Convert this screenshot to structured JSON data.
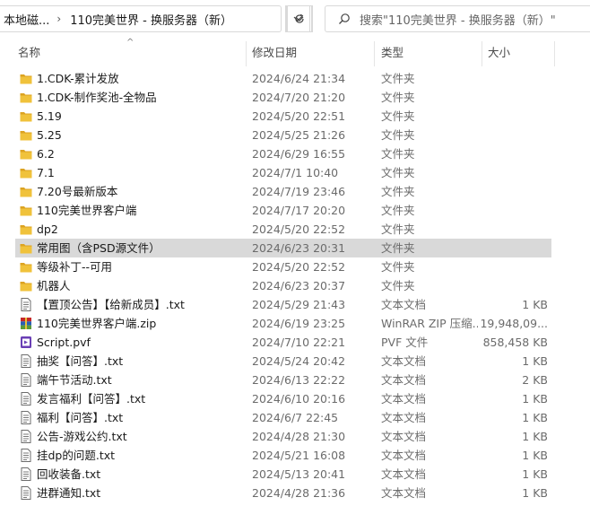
{
  "address": {
    "root": "本地磁...",
    "separator": "›",
    "current": "110完美世界 - 换服务器（新）",
    "dropdown_icon": "⌄",
    "refresh_icon": "↻"
  },
  "search": {
    "placeholder": "搜索\"110完美世界 - 换服务器（新）\""
  },
  "header": {
    "name": "名称",
    "date": "修改日期",
    "type": "类型",
    "size": "大小",
    "sort_indicator": "^"
  },
  "files": [
    {
      "name": "1.CDK-累计发放",
      "date": "2024/6/24 21:34",
      "type": "文件夹",
      "size": "",
      "icon": "folder-icon"
    },
    {
      "name": "1.CDK-制作奖池-全物品",
      "date": "2024/7/20 21:20",
      "type": "文件夹",
      "size": "",
      "icon": "folder-icon"
    },
    {
      "name": "5.19",
      "date": "2024/5/20 22:51",
      "type": "文件夹",
      "size": "",
      "icon": "folder-icon"
    },
    {
      "name": "5.25",
      "date": "2024/5/25 21:26",
      "type": "文件夹",
      "size": "",
      "icon": "folder-icon"
    },
    {
      "name": "6.2",
      "date": "2024/6/29 16:55",
      "type": "文件夹",
      "size": "",
      "icon": "folder-icon"
    },
    {
      "name": "7.1",
      "date": "2024/7/1 10:40",
      "type": "文件夹",
      "size": "",
      "icon": "folder-icon"
    },
    {
      "name": "7.20号最新版本",
      "date": "2024/7/19 23:46",
      "type": "文件夹",
      "size": "",
      "icon": "folder-icon"
    },
    {
      "name": "110完美世界客户端",
      "date": "2024/7/17 20:20",
      "type": "文件夹",
      "size": "",
      "icon": "folder-icon"
    },
    {
      "name": "dp2",
      "date": "2024/5/20 22:52",
      "type": "文件夹",
      "size": "",
      "icon": "folder-icon"
    },
    {
      "name": "常用图（含PSD源文件）",
      "date": "2024/6/23 20:31",
      "type": "文件夹",
      "size": "",
      "icon": "folder-icon",
      "selected": true
    },
    {
      "name": "等级补丁--可用",
      "date": "2024/5/20 22:52",
      "type": "文件夹",
      "size": "",
      "icon": "folder-icon"
    },
    {
      "name": "机器人",
      "date": "2024/6/23 20:37",
      "type": "文件夹",
      "size": "",
      "icon": "folder-icon"
    },
    {
      "name": "【置顶公告】【给新成员】.txt",
      "date": "2024/5/29 21:43",
      "type": "文本文档",
      "size": "1 KB",
      "icon": "text-file-icon"
    },
    {
      "name": "110完美世界客户端.zip",
      "date": "2024/6/19 23:25",
      "type": "WinRAR ZIP 压缩...",
      "size": "19,948,09...",
      "icon": "zip-archive-icon"
    },
    {
      "name": "Script.pvf",
      "date": "2024/7/10 22:21",
      "type": "PVF 文件",
      "size": "858,458 KB",
      "icon": "pvf-file-icon"
    },
    {
      "name": "抽奖【问答】.txt",
      "date": "2024/5/24 20:42",
      "type": "文本文档",
      "size": "1 KB",
      "icon": "text-file-icon"
    },
    {
      "name": "端午节活动.txt",
      "date": "2024/6/13 22:22",
      "type": "文本文档",
      "size": "2 KB",
      "icon": "text-file-icon"
    },
    {
      "name": "发言福利【问答】.txt",
      "date": "2024/6/10 20:16",
      "type": "文本文档",
      "size": "1 KB",
      "icon": "text-file-icon"
    },
    {
      "name": "福利【问答】.txt",
      "date": "2024/6/7 22:45",
      "type": "文本文档",
      "size": "1 KB",
      "icon": "text-file-icon"
    },
    {
      "name": "公告-游戏公约.txt",
      "date": "2024/4/28 21:30",
      "type": "文本文档",
      "size": "1 KB",
      "icon": "text-file-icon"
    },
    {
      "name": "挂dp的问题.txt",
      "date": "2024/5/21 16:08",
      "type": "文本文档",
      "size": "1 KB",
      "icon": "text-file-icon"
    },
    {
      "name": "回收装备.txt",
      "date": "2024/5/13 20:41",
      "type": "文本文档",
      "size": "1 KB",
      "icon": "text-file-icon"
    },
    {
      "name": "进群通知.txt",
      "date": "2024/4/28 21:36",
      "type": "文本文档",
      "size": "1 KB",
      "icon": "text-file-icon"
    }
  ],
  "colors": {
    "folder": "#f0c23b",
    "folder_dark": "#dca322",
    "selection": "#d9d9d9",
    "pvf": "#6a3fb5",
    "zip_red": "#c62828",
    "zip_blue": "#2b5fb3"
  }
}
